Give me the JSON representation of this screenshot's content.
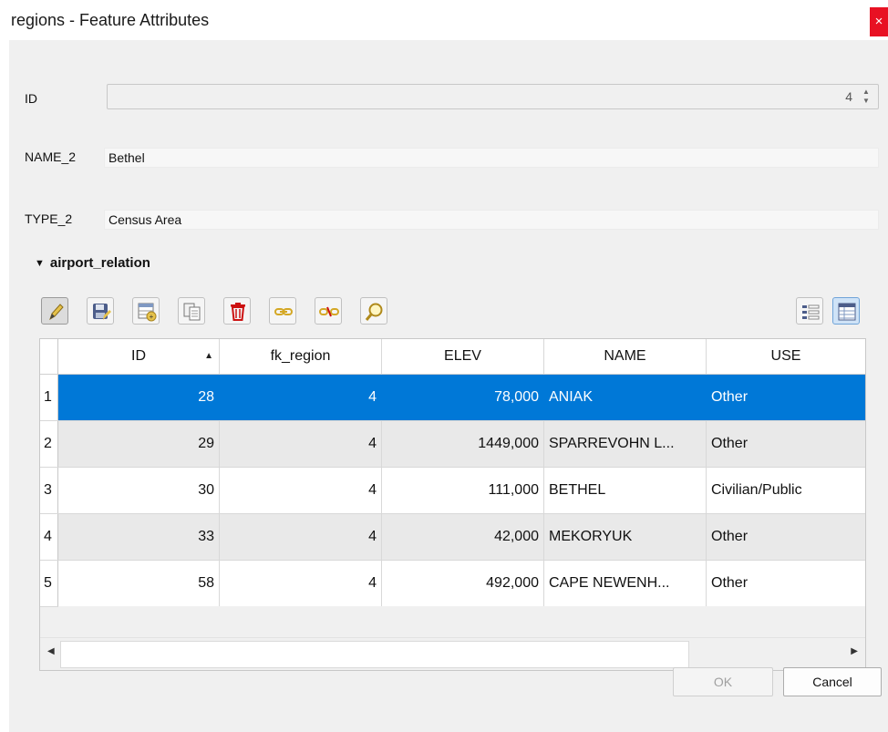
{
  "window": {
    "title": "regions - Feature Attributes",
    "close_label": "×"
  },
  "form": {
    "id_label": "ID",
    "id_value": "4",
    "name_label": "NAME_2",
    "name_value": "Bethel",
    "type_label": "TYPE_2",
    "type_value": "Census Area"
  },
  "relation": {
    "title": "airport_relation",
    "toolbar_icons": [
      "pencil-icon",
      "save-edits-icon",
      "add-feature-icon",
      "duplicate-feature-icon",
      "delete-feature-icon",
      "link-feature-icon",
      "unlink-feature-icon",
      "zoom-to-feature-icon",
      "form-view-icon",
      "table-view-icon"
    ],
    "columns": [
      "ID",
      "fk_region",
      "ELEV",
      "NAME",
      "USE"
    ],
    "rows": [
      {
        "num": "1",
        "id": "28",
        "fk": "4",
        "elev": "78,000",
        "name": "ANIAK",
        "use": "Other"
      },
      {
        "num": "2",
        "id": "29",
        "fk": "4",
        "elev": "1449,000",
        "name": "SPARREVOHN L...",
        "use": "Other"
      },
      {
        "num": "3",
        "id": "30",
        "fk": "4",
        "elev": "111,000",
        "name": "BETHEL",
        "use": "Civilian/Public"
      },
      {
        "num": "4",
        "id": "33",
        "fk": "4",
        "elev": "42,000",
        "name": "MEKORYUK",
        "use": "Other"
      },
      {
        "num": "5",
        "id": "58",
        "fk": "4",
        "elev": "492,000",
        "name": "CAPE NEWENH...",
        "use": "Other"
      }
    ]
  },
  "buttons": {
    "ok": "OK",
    "cancel": "Cancel"
  },
  "colors": {
    "selection": "#0078d7",
    "close": "#e81123",
    "delete": "#cc1111"
  }
}
